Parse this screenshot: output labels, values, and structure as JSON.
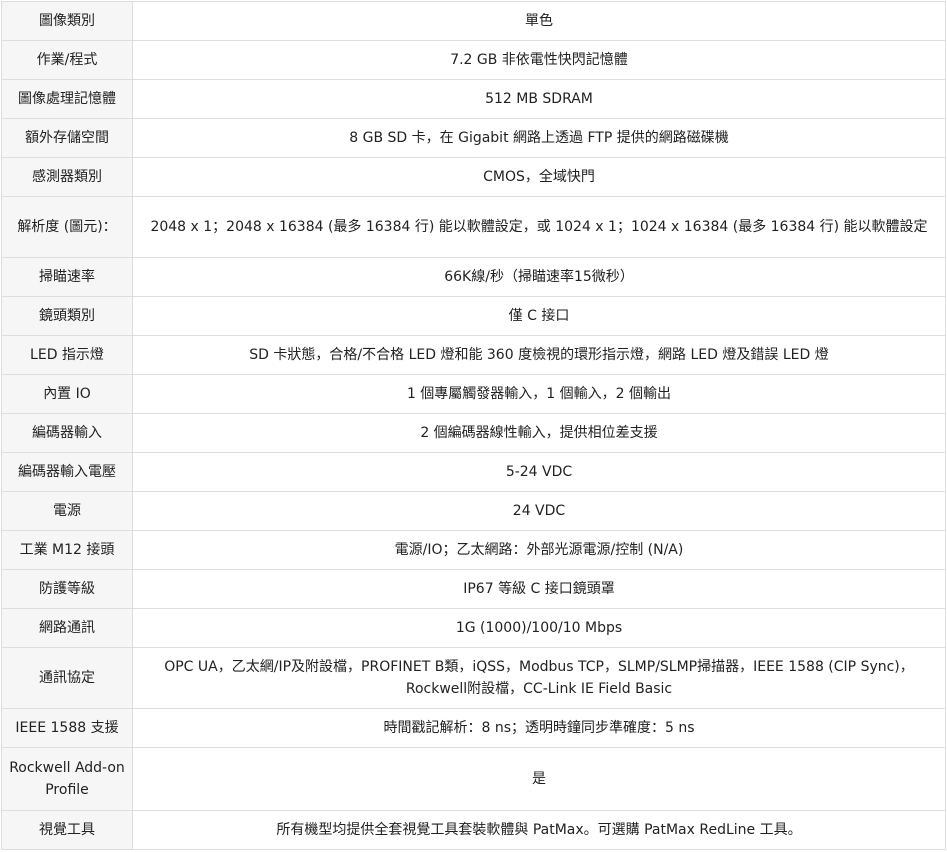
{
  "specs": [
    {
      "label": "圖像類別",
      "value": "單色"
    },
    {
      "label": "作業/程式",
      "value": "7.2 GB 非依電性快閃記憶體"
    },
    {
      "label": "圖像處理記憶體",
      "value": "512 MB SDRAM"
    },
    {
      "label": "額外存儲空間",
      "value": "8 GB SD 卡，在 Gigabit 網路上透過 FTP 提供的網路磁碟機"
    },
    {
      "label": "感測器類別",
      "value": "CMOS，全域快門"
    },
    {
      "label": "解析度 (圖元)：",
      "value": "2048 x 1；2048 x 16384 (最多 16384 行) 能以軟體設定，或 1024 x 1；1024 x 16384 (最多 16384 行) 能以軟體設定"
    },
    {
      "label": "掃瞄速率",
      "value": "66K線/秒（掃瞄速率15微秒）"
    },
    {
      "label": "鏡頭類別",
      "value": "僅 C 接口"
    },
    {
      "label": "LED 指示燈",
      "value": "SD 卡狀態，合格/不合格 LED 燈和能 360 度檢視的環形指示燈，網路 LED 燈及錯誤 LED 燈"
    },
    {
      "label": "內置 IO",
      "value": "1 個專屬觸發器輸入，1 個輸入，2 個輸出"
    },
    {
      "label": "編碼器輸入",
      "value": "2 個編碼器線性輸入，提供相位差支援"
    },
    {
      "label": "編碼器輸入電壓",
      "value": "5-24 VDC"
    },
    {
      "label": "電源",
      "value": "24 VDC"
    },
    {
      "label": "工業 M12 接頭",
      "value": "電源/IO；乙太網路：外部光源電源/控制 (N/A)"
    },
    {
      "label": "防護等級",
      "value": "IP67 等級 C 接口鏡頭罩"
    },
    {
      "label": "網路通訊",
      "value": "1G (1000)/100/10 Mbps"
    },
    {
      "label": "通訊協定",
      "value": "OPC UA，乙太網/IP及附設檔，PROFINET B類，iQSS，Modbus TCP，SLMP/SLMP掃描器，IEEE 1588 (CIP Sync)，Rockwell附設檔，CC-Link IE Field Basic"
    },
    {
      "label": "IEEE 1588 支援",
      "value": "時間戳記解析：8 ns；透明時鐘同步準確度：5 ns"
    },
    {
      "label": "Rockwell Add-on Profile",
      "value": "是"
    },
    {
      "label": "視覺工具",
      "value": "所有機型均提供全套視覺工具套裝軟體與 PatMax。可選購 PatMax RedLine 工具。"
    }
  ]
}
